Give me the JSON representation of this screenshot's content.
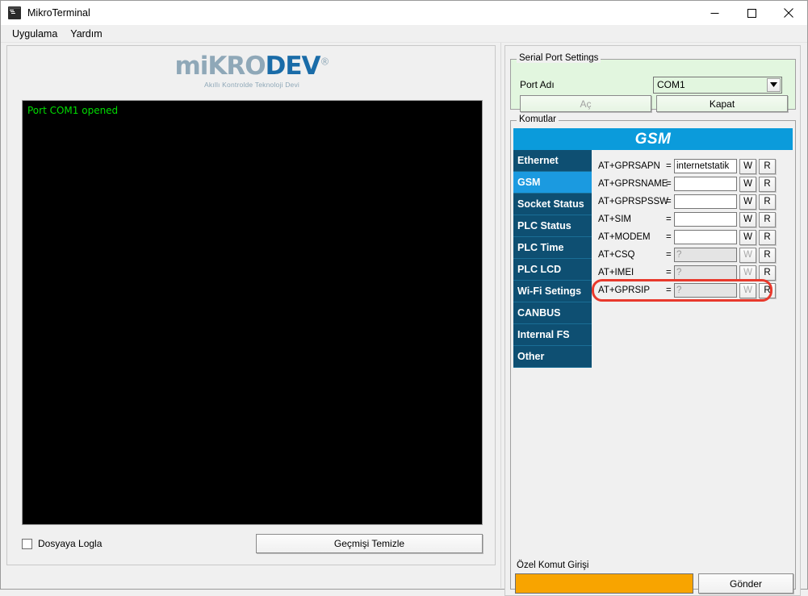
{
  "window": {
    "title": "MikroTerminal",
    "icon": "terminal-icon",
    "controls": {
      "minimize": "minimize-icon",
      "maximize": "maximize-icon",
      "close": "close-icon"
    }
  },
  "menubar": {
    "items": [
      {
        "label": "Uygulama"
      },
      {
        "label": "Yardım"
      }
    ]
  },
  "logo": {
    "part1": "miKRO",
    "part2": "DEV",
    "registered": "®",
    "tagline": "Akıllı Kontrolde Teknoloji Devi"
  },
  "terminal": {
    "lines": [
      "Port COM1 opened"
    ],
    "text_color": "#00dd00",
    "background": "#000000"
  },
  "left_footer": {
    "log_checkbox_label": "Dosyaya Logla",
    "log_checkbox_checked": false,
    "clear_button_label": "Geçmişi Temizle"
  },
  "serial_port_settings": {
    "group_title": "Serial Port Settings",
    "port_label": "Port Adı",
    "port_value": "COM1",
    "port_options": [
      "COM1"
    ],
    "open_button_label": "Aç",
    "open_button_enabled": false,
    "close_button_label": "Kapat",
    "close_button_enabled": true,
    "background": "#e2f6df"
  },
  "commands": {
    "group_title": "Komutlar",
    "header_title": "GSM",
    "header_color": "#0b9bdb",
    "sidebar": [
      {
        "label": "Ethernet",
        "active": false
      },
      {
        "label": "GSM",
        "active": true
      },
      {
        "label": "Socket Status",
        "active": false
      },
      {
        "label": "PLC Status",
        "active": false
      },
      {
        "label": "PLC Time",
        "active": false
      },
      {
        "label": "PLC LCD",
        "active": false
      },
      {
        "label": "Wi-Fi Setings",
        "active": false
      },
      {
        "label": "CANBUS",
        "active": false
      },
      {
        "label": "Internal FS",
        "active": false
      },
      {
        "label": "Other",
        "active": false
      }
    ],
    "equals_sign": "=",
    "write_button_label": "W",
    "read_button_label": "R",
    "rows": [
      {
        "label": "AT+GPRSAPN",
        "value": "internetstatik",
        "placeholder": "",
        "enabled": true,
        "write_enabled": true,
        "highlighted": false
      },
      {
        "label": "AT+GPRSNAME",
        "value": "",
        "placeholder": "",
        "enabled": true,
        "write_enabled": true,
        "highlighted": false
      },
      {
        "label": "AT+GPRSPSSW",
        "value": "",
        "placeholder": "",
        "enabled": true,
        "write_enabled": true,
        "highlighted": false
      },
      {
        "label": "AT+SIM",
        "value": "",
        "placeholder": "",
        "enabled": true,
        "write_enabled": true,
        "highlighted": false
      },
      {
        "label": "AT+MODEM",
        "value": "",
        "placeholder": "",
        "enabled": true,
        "write_enabled": true,
        "highlighted": false
      },
      {
        "label": "AT+CSQ",
        "value": "?",
        "placeholder": "?",
        "enabled": false,
        "write_enabled": false,
        "highlighted": false
      },
      {
        "label": "AT+IMEI",
        "value": "?",
        "placeholder": "?",
        "enabled": false,
        "write_enabled": false,
        "highlighted": false
      },
      {
        "label": "AT+GPRSIP",
        "value": "?",
        "placeholder": "?",
        "enabled": false,
        "write_enabled": false,
        "highlighted": true
      }
    ],
    "annotation": {
      "shape": "rounded-rectangle",
      "color": "#e8392c",
      "target_row": "AT+GPRSIP"
    }
  },
  "custom_command": {
    "label": "Özel Komut Girişi",
    "value": "",
    "input_color": "#f8a400",
    "send_button_label": "Gönder"
  }
}
